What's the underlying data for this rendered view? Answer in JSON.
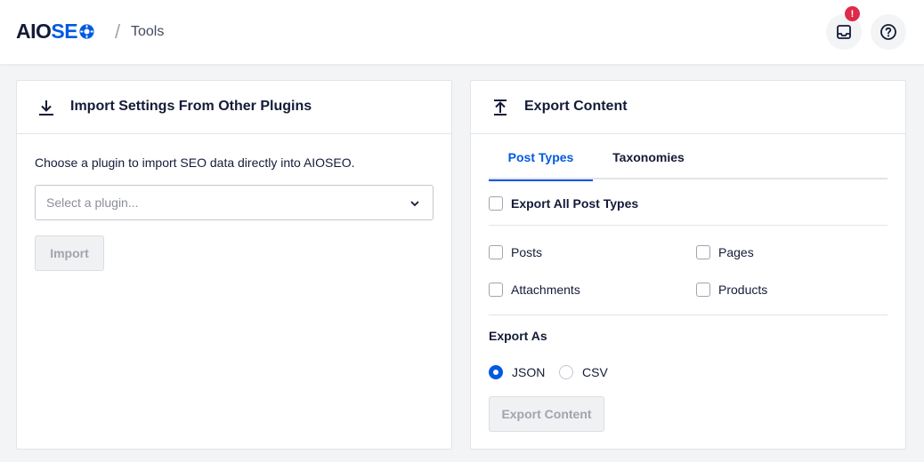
{
  "header": {
    "logo": {
      "part1": "AIO",
      "part2": "S",
      "part3": "E"
    },
    "separator": "/",
    "page": "Tools",
    "notification_count": "!"
  },
  "import_card": {
    "title": "Import Settings From Other Plugins",
    "description": "Choose a plugin to import SEO data directly into AIOSEO.",
    "select_placeholder": "Select a plugin...",
    "import_button": "Import"
  },
  "export_card": {
    "title": "Export Content",
    "tabs": [
      {
        "label": "Post Types",
        "active": true
      },
      {
        "label": "Taxonomies",
        "active": false
      }
    ],
    "export_all_label": "Export All Post Types",
    "post_types": [
      {
        "label": "Posts",
        "checked": false
      },
      {
        "label": "Pages",
        "checked": false
      },
      {
        "label": "Attachments",
        "checked": false
      },
      {
        "label": "Products",
        "checked": false
      }
    ],
    "export_as_label": "Export As",
    "formats": [
      {
        "label": "JSON",
        "selected": true
      },
      {
        "label": "CSV",
        "selected": false
      }
    ],
    "export_button": "Export Content"
  },
  "colors": {
    "brand_blue": "#005ae0",
    "navy": "#141b38",
    "alert_red": "#df2a4a"
  },
  "icons": [
    "cog-logo-icon",
    "inbox-icon",
    "help-icon",
    "download-icon",
    "upload-icon",
    "chevron-down-icon"
  ]
}
